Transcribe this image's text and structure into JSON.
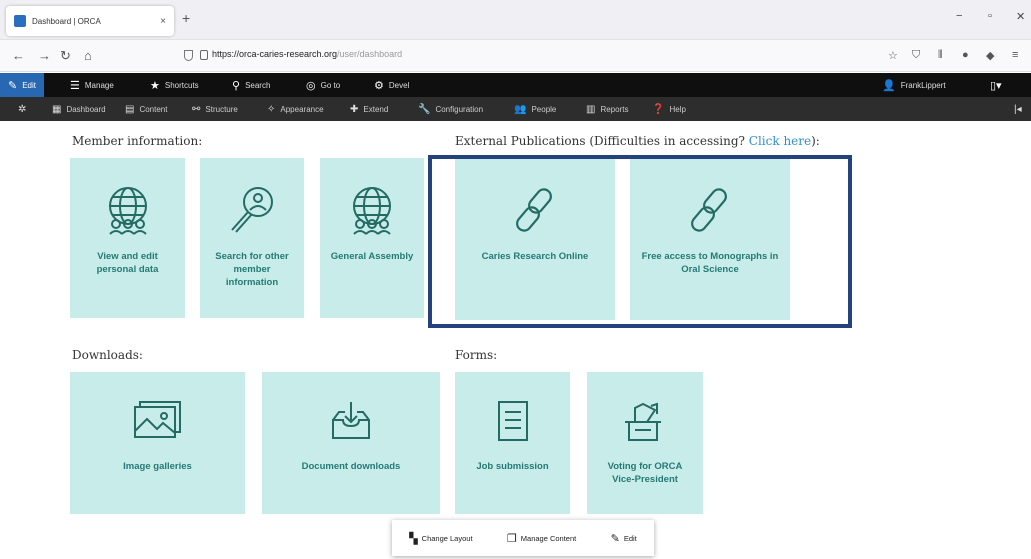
{
  "browser": {
    "tab_title": "Dashboard | ORCA",
    "tab_close": "×",
    "new_tab": "+",
    "url_domain": "https://orca-caries-research.org",
    "url_path": "/user/dashboard",
    "win_min": "−",
    "win_max": "▫",
    "win_close": "✕"
  },
  "toolbar": {
    "edit": "Edit",
    "manage": "Manage",
    "shortcuts": "Shortcuts",
    "search": "Search",
    "goto": "Go to",
    "devel": "Devel",
    "user": "FrankLippert"
  },
  "admin_menu": {
    "dashboard": "Dashboard",
    "content": "Content",
    "structure": "Structure",
    "appearance": "Appearance",
    "extend": "Extend",
    "configuration": "Configuration",
    "people": "People",
    "reports": "Reports",
    "help": "Help"
  },
  "sections": {
    "member": "Member information:",
    "external": "External Publications (Difficulties in accessing?",
    "external_link": "Click here",
    "external_end": "):",
    "downloads": "Downloads:",
    "forms": "Forms:"
  },
  "tiles": {
    "view_edit": "View and edit personal data",
    "search_member": "Search for other member information",
    "general_assembly": "General Assembly",
    "caries_online": "Caries Research Online",
    "monographs": "Free access to Monographs in Oral Science",
    "image_galleries": "Image galleries",
    "document_downloads": "Document downloads",
    "job_submission": "Job submission",
    "voting": "Voting for ORCA Vice-President"
  },
  "popup": {
    "change_layout": "Change Layout",
    "manage_content": "Manage Content",
    "edit": "Edit"
  },
  "colors": {
    "tile_bg": "#c7ecea",
    "tile_text": "#257a73",
    "highlight_border": "#24427e",
    "toolbar_edit": "#2867b2"
  }
}
